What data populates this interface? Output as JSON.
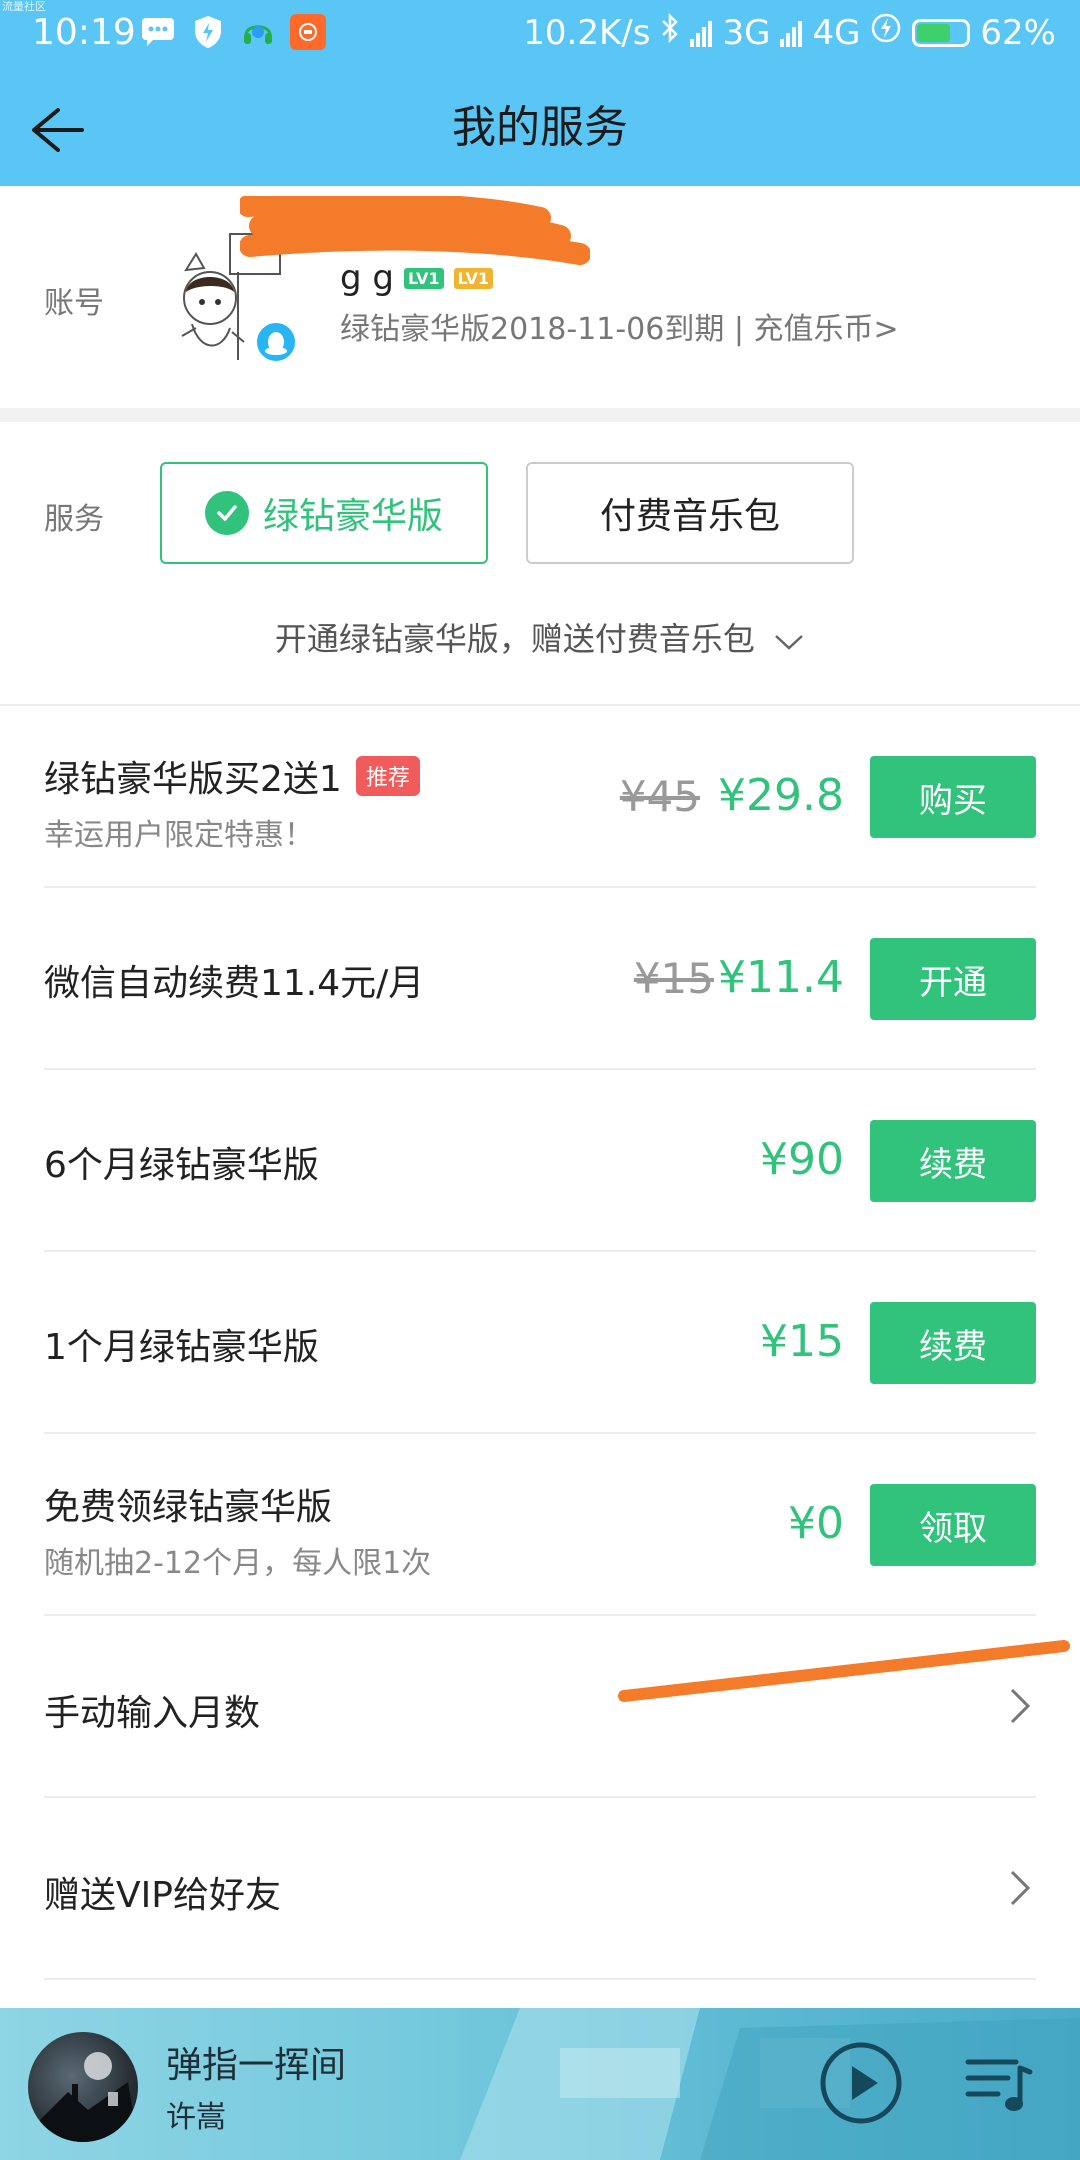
{
  "status_bar": {
    "tiny_text": "流量社区",
    "time": "10:19",
    "net_speed": "10.2K/s",
    "net_3g": "3G",
    "net_4g": "4G",
    "battery": "62%",
    "battery_level": 0.62
  },
  "header": {
    "title": "我的服务"
  },
  "account": {
    "label": "账号",
    "username": "g          g",
    "level_badges": [
      "LV1",
      "LV1"
    ],
    "subtitle": "绿钻豪华版2018-11-06到期 | 充值乐币>"
  },
  "service": {
    "label": "服务",
    "options": [
      "绿钻豪华版",
      "付费音乐包"
    ],
    "selected": "绿钻豪华版",
    "note": "开通绿钻豪华版，赠送付费音乐包"
  },
  "plans": [
    {
      "title": "绿钻豪华版买2送1",
      "tag": "推荐",
      "subtitle": "幸运用户限定特惠！",
      "old_price": "¥45",
      "price": "¥29.8",
      "button": "购买"
    },
    {
      "title": "微信自动续费11.4元/月",
      "old_price": "¥15",
      "price": "¥11.4",
      "button": "开通"
    },
    {
      "title": "6个月绿钻豪华版",
      "price": "¥90",
      "button": "续费"
    },
    {
      "title": "1个月绿钻豪华版",
      "price": "¥15",
      "button": "续费"
    },
    {
      "title": "免费领绿钻豪华版",
      "subtitle": "随机抽2-12个月，每人限1次",
      "price": "¥0",
      "button": "领取"
    }
  ],
  "links": [
    {
      "label": "手动输入月数"
    },
    {
      "label": "赠送VIP给好友"
    }
  ],
  "player": {
    "song": "弹指一挥间",
    "artist": "许嵩"
  },
  "colors": {
    "header_bg": "#5ac6f5",
    "accent_green": "#31c27c",
    "tag_red": "#f05b5b"
  }
}
